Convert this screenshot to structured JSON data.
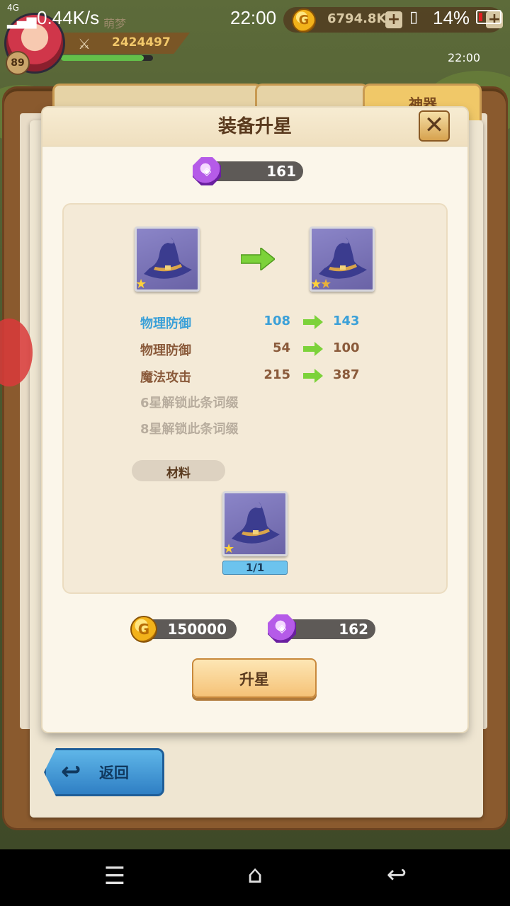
{
  "status_bar": {
    "network": "4G",
    "speed": "0.44K/s",
    "time": "22:00",
    "battery": "14%"
  },
  "hud": {
    "player_name": "萌梦",
    "level": "89",
    "power": "2424497",
    "xp_fraction": 0.9,
    "gold": "6794.8K",
    "clock": "22:00"
  },
  "background_tabs": {
    "right_tab": "神器"
  },
  "dialog": {
    "title": "装备升星",
    "close_icon": "close-x",
    "gem_balance": "161",
    "item_name": "wizard-hat",
    "from_stars": 1,
    "to_stars": 2,
    "stats": [
      {
        "label": "物理防御",
        "old": "108",
        "new": "143",
        "highlight": true
      },
      {
        "label": "物理防御",
        "old": "54",
        "new": "100",
        "highlight": false
      },
      {
        "label": "魔法攻击",
        "old": "215",
        "new": "387",
        "highlight": false
      }
    ],
    "locked_lines": [
      "6星解锁此条词缀",
      "8星解锁此条词缀"
    ],
    "materials_label": "材料",
    "material_count": "1/1",
    "cost_gold": "150000",
    "cost_gem": "162",
    "upgrade_button": "升星"
  },
  "back_button": "返回",
  "colors": {
    "highlight_stat": "#3aa0d8",
    "normal_stat": "#8a5a3a",
    "locked_text": "#b8ad9e",
    "arrow_green": "#7cd23a"
  }
}
